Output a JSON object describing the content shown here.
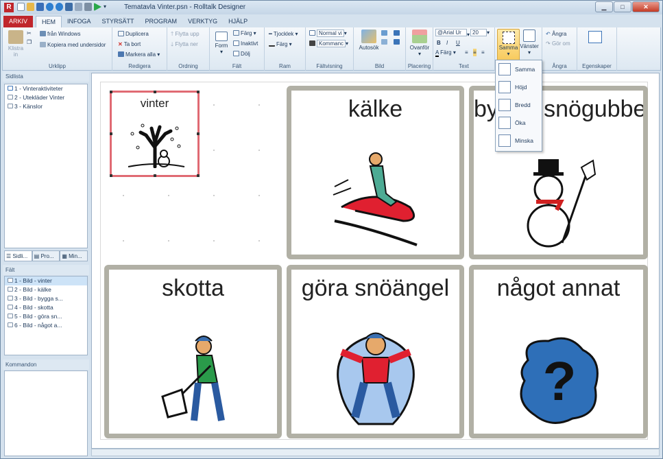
{
  "window": {
    "title": "Tematavla Vinter.psn - Rolltalk Designer",
    "app_letter": "R",
    "qat_extra": "▾"
  },
  "tabs": [
    "ARKIV",
    "HEM",
    "INFOGA",
    "STYRSÄTT",
    "PROGRAM",
    "VERKTYG",
    "HJÄLP"
  ],
  "ribbon": {
    "urklipp": {
      "paste": "Klistra",
      "paste2": "in",
      "from_windows": "från Windows",
      "copy_sub": "Kopiera med undersidor",
      "label": "Urklipp"
    },
    "redigera": {
      "duplicate": "Duplicera",
      "delete": "Ta bort",
      "select_all": "Markera alla",
      "label": "Redigera"
    },
    "ordning": {
      "move_up": "Flytta upp",
      "move_down": "Flytta ner",
      "label": "Ordning"
    },
    "falt": {
      "form": "Form",
      "color": "Färg",
      "inactive": "Inaktivt",
      "hide": "Dölj",
      "label": "Fält"
    },
    "ram": {
      "thickness": "Tjocklek",
      "color": "Färg",
      "label": "Ram"
    },
    "faltvisning": {
      "normal": "Normal vi",
      "command": "Kommanc",
      "label": "Fältvisning"
    },
    "bild": {
      "autosok": "Autosök",
      "label": "Bild"
    },
    "placering": {
      "above": "Ovanför",
      "label": "Placering"
    },
    "text": {
      "font": "@Arial Ur",
      "size": "20",
      "bold": "B",
      "italic": "I",
      "underline": "U",
      "color": "Färg",
      "label": "Text"
    },
    "storlek": {
      "same": "Samma",
      "left": "Vänster"
    },
    "angra": {
      "undo": "Ångra",
      "redo": "Gör om",
      "label": "Ångra"
    },
    "egenskaper": {
      "label": "Egenskaper"
    }
  },
  "sidlista": {
    "title": "Sidlista",
    "items": [
      "1 - Vinteraktiviteter",
      "2 - Utekläder Vinter",
      "3 - Känslor"
    ]
  },
  "panel_tabs": [
    "Sidli...",
    "Pro...",
    "Min..."
  ],
  "falt": {
    "title": "Fält",
    "items": [
      "1 - Bild - vinter",
      "2 - Bild - kälke",
      "3 - Bild - bygga s...",
      "4 - Bild - skotta",
      "5 - Bild - göra sn...",
      "6 - Bild - något a..."
    ]
  },
  "kommandon": {
    "title": "Kommandon"
  },
  "cells": {
    "mini": "vinter",
    "c1": "kälke",
    "c2": "bygga snögubbe",
    "c3": "skotta",
    "c4": "göra snöängel",
    "c5": "något annat"
  },
  "dropdown": [
    "Samma",
    "Höjd",
    "Bredd",
    "Öka",
    "Minska"
  ]
}
